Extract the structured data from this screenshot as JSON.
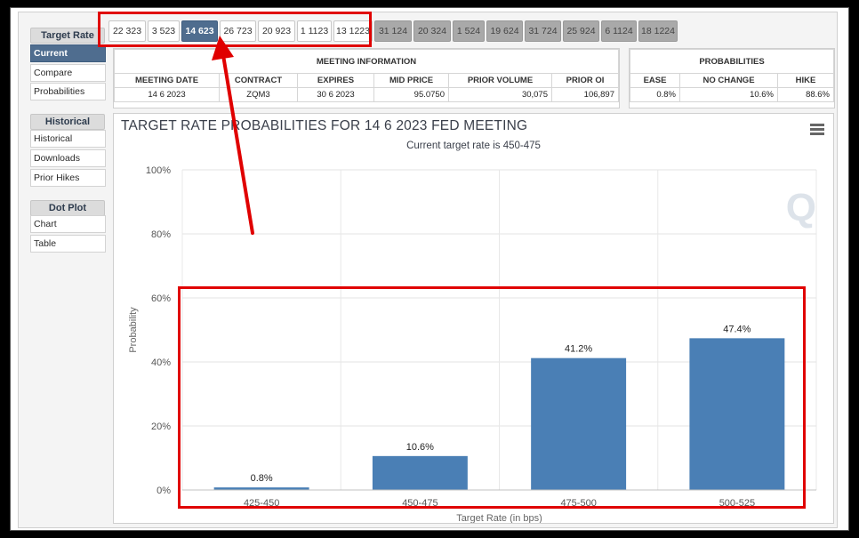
{
  "sidebar": {
    "target_rate_header": "Target Rate",
    "current": "Current",
    "compare": "Compare",
    "probabilities": "Probabilities",
    "historical_header": "Historical",
    "historical": "Historical",
    "downloads": "Downloads",
    "prior_hikes": "Prior Hikes",
    "dot_plot_header": "Dot Plot",
    "chart": "Chart",
    "table": "Table"
  },
  "tabs": [
    "22 323",
    "3 523",
    "14 623",
    "26 723",
    "20 923",
    "1 1123",
    "13 1223",
    "31 124",
    "20 324",
    "1 524",
    "19 624",
    "31 724",
    "25 924",
    "6 1124",
    "18 1224"
  ],
  "active_tab": "14 623",
  "meeting_info": {
    "header": "MEETING INFORMATION",
    "columns": [
      "MEETING DATE",
      "CONTRACT",
      "EXPIRES",
      "MID PRICE",
      "PRIOR VOLUME",
      "PRIOR OI"
    ],
    "row": [
      "14 6 2023",
      "ZQM3",
      "30 6 2023",
      "95.0750",
      "30,075",
      "106,897"
    ]
  },
  "probabilities_table": {
    "header": "PROBABILITIES",
    "columns": [
      "EASE",
      "NO CHANGE",
      "HIKE"
    ],
    "row": [
      "0.8%",
      "10.6%",
      "88.6%"
    ]
  },
  "chart": {
    "title": "TARGET RATE PROBABILITIES FOR 14 6 2023 FED MEETING",
    "subtitle": "Current target rate is 450-475",
    "watermark": "Q",
    "menu_icon": "hamburger-icon"
  },
  "chart_data": {
    "type": "bar",
    "categories": [
      "425-450",
      "450-475",
      "475-500",
      "500-525"
    ],
    "values": [
      0.8,
      10.6,
      41.2,
      47.4
    ],
    "value_labels": [
      "0.8%",
      "10.6%",
      "41.2%",
      "47.4%"
    ],
    "ylabel": "Probability",
    "xlabel": "Target Rate (in bps)",
    "ylim": [
      0,
      100
    ],
    "yticks": [
      0,
      20,
      40,
      60,
      80,
      100
    ],
    "ytick_labels": [
      "0%",
      "20%",
      "40%",
      "60%",
      "80%",
      "100%"
    ],
    "grid": true,
    "bar_color": "#4a7fb5"
  },
  "colors": {
    "accent": "#4f6d8f",
    "annotation": "#e00000"
  }
}
